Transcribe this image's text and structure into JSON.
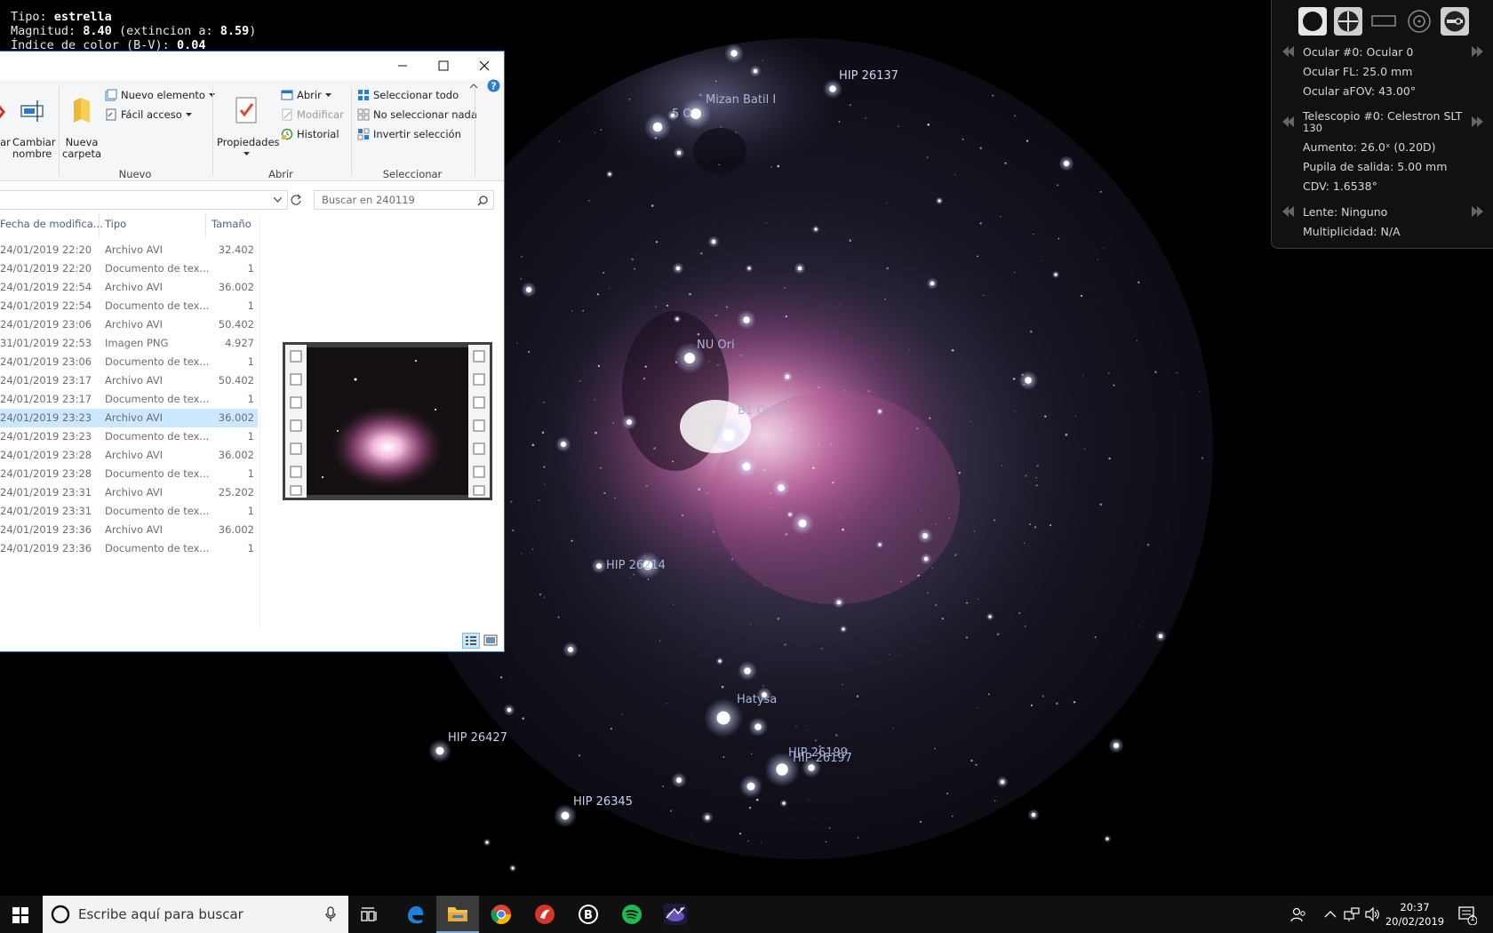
{
  "object_info": {
    "type_label": "Tipo:",
    "type_value": "estrella",
    "magnitude_label": "Magnitud:",
    "magnitude_value": "8.40",
    "extinction_label": "(extincion a:",
    "extinction_value": "8.59",
    "extinction_close": ")",
    "color_index_label": "Índice de color (B-V):",
    "color_index_value": "0.04"
  },
  "star_labels": [
    {
      "id": "hip-26137",
      "text": "HIP 26137"
    },
    {
      "id": "mizan-batil",
      "text": "Mizan Batil I"
    },
    {
      "id": "five-o",
      "text": "5 O"
    },
    {
      "id": "nu-ori",
      "text": "NU Ori"
    },
    {
      "id": "b1-ori",
      "text": "B1 Ori C"
    },
    {
      "id": "hip-26214",
      "text": "HIP 26214"
    },
    {
      "id": "hatysa",
      "text": "Hatysa"
    },
    {
      "id": "hip-26427",
      "text": "HIP 26427"
    },
    {
      "id": "hip-26199",
      "text": "HIP 26199"
    },
    {
      "id": "hip-26197",
      "text": "HIP 26197"
    },
    {
      "id": "hip-26345",
      "text": "HIP 26345"
    }
  ],
  "ocular_panel": {
    "ocular": "Ocular #0: Ocular 0",
    "ocular_fl": "Ocular FL: 25.0 mm",
    "ocular_afov": "Ocular aFOV: 43.00°",
    "telescope_line1": "Telescopio #0: Celestron SLT",
    "telescope_line2": "130",
    "magnification": "Aumento: 26.0ˣ (0.20D)",
    "exit_pupil": "Pupila de salida: 5.00 mm",
    "fov": "CDV: 1.6538°",
    "lens": "Lente: Ninguno",
    "multiplicity": "Multiplicidad: N/A"
  },
  "explorer": {
    "ribbon": {
      "delete_partial": "ar",
      "rename_line1": "Cambiar",
      "rename_line2": "nombre",
      "new_folder_line1": "Nueva",
      "new_folder_line2": "carpeta",
      "new_item": "Nuevo elemento",
      "easy_access": "Fácil acceso",
      "group_new": "Nuevo",
      "properties": "Propiedades",
      "open": "Abrir",
      "edit": "Modificar",
      "history": "Historial",
      "group_open": "Abrir",
      "select_all": "Seleccionar todo",
      "select_none": "No seleccionar nada",
      "invert_selection": "Invertir selección",
      "group_select": "Seleccionar"
    },
    "search_placeholder": "Buscar en 240119",
    "columns": {
      "date": "Fecha de modifica...",
      "type": "Tipo",
      "size": "Tamaño"
    },
    "rows": [
      {
        "date": "24/01/2019 22:20",
        "type": "Archivo AVI",
        "size": "32.402"
      },
      {
        "date": "24/01/2019 22:20",
        "type": "Documento de tex...",
        "size": "1"
      },
      {
        "date": "24/01/2019 22:54",
        "type": "Archivo AVI",
        "size": "36.002"
      },
      {
        "date": "24/01/2019 22:54",
        "type": "Documento de tex...",
        "size": "1"
      },
      {
        "date": "24/01/2019 23:06",
        "type": "Archivo AVI",
        "size": "50.402"
      },
      {
        "date": "31/01/2019 22:53",
        "type": "Imagen PNG",
        "size": "4.927"
      },
      {
        "date": "24/01/2019 23:06",
        "type": "Documento de tex...",
        "size": "1"
      },
      {
        "date": "24/01/2019 23:17",
        "type": "Archivo AVI",
        "size": "50.402"
      },
      {
        "date": "24/01/2019 23:17",
        "type": "Documento de tex...",
        "size": "1"
      },
      {
        "date": "24/01/2019 23:23",
        "type": "Archivo AVI",
        "size": "36.002"
      },
      {
        "date": "24/01/2019 23:23",
        "type": "Documento de tex...",
        "size": "1"
      },
      {
        "date": "24/01/2019 23:28",
        "type": "Archivo AVI",
        "size": "36.002"
      },
      {
        "date": "24/01/2019 23:28",
        "type": "Documento de tex...",
        "size": "1"
      },
      {
        "date": "24/01/2019 23:31",
        "type": "Archivo AVI",
        "size": "25.202"
      },
      {
        "date": "24/01/2019 23:31",
        "type": "Documento de tex...",
        "size": "1"
      },
      {
        "date": "24/01/2019 23:36",
        "type": "Archivo AVI",
        "size": "36.002"
      },
      {
        "date": "24/01/2019 23:36",
        "type": "Documento de tex...",
        "size": "1"
      }
    ],
    "selected_row": 9
  },
  "taskbar": {
    "search_placeholder": "Escribe aquí para buscar",
    "time": "20:37",
    "date": "20/02/2019",
    "notification_count": "1",
    "apps": [
      "task-view-icon",
      "edge-icon",
      "file-explorer-icon",
      "chrome-icon",
      "red-app-icon",
      "app-b-icon",
      "spotify-icon",
      "stellarium-icon"
    ]
  },
  "colors": {
    "sky_background": "#000000",
    "nebula_pink": "#c25a9a",
    "selection": "#cce8ff",
    "window_border": "#1979ca",
    "taskbar": "#101010"
  }
}
